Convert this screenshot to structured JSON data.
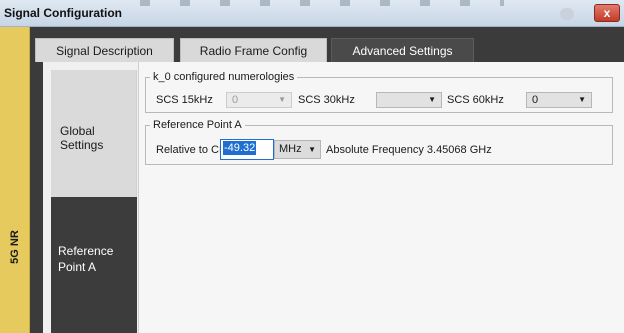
{
  "window": {
    "title": "Signal Configuration",
    "close_label": "x"
  },
  "sidebar": {
    "label": "5G NR"
  },
  "tabs": [
    {
      "label": "Signal Description"
    },
    {
      "label": "Radio Frame Config"
    },
    {
      "label": "Advanced Settings"
    }
  ],
  "subnav": [
    {
      "label": "Global Settings"
    },
    {
      "label": "Reference Point A"
    }
  ],
  "numerologies": {
    "legend": "k_0 configured numerologies",
    "scs15_label": "SCS 15kHz",
    "scs15_value": "0",
    "scs30_label": "SCS 30kHz",
    "scs30_value": "",
    "scs60_label": "SCS 60kHz",
    "scs60_value": "0"
  },
  "reference_point": {
    "legend": "Reference Point A",
    "relative_label": "Relative to CF",
    "relative_value": "-49.32",
    "unit": "MHz",
    "absolute_text": "Absolute Frequency 3.45068 GHz"
  },
  "icons": {
    "dropdown": "chevron-down-icon",
    "close": "close-icon"
  }
}
